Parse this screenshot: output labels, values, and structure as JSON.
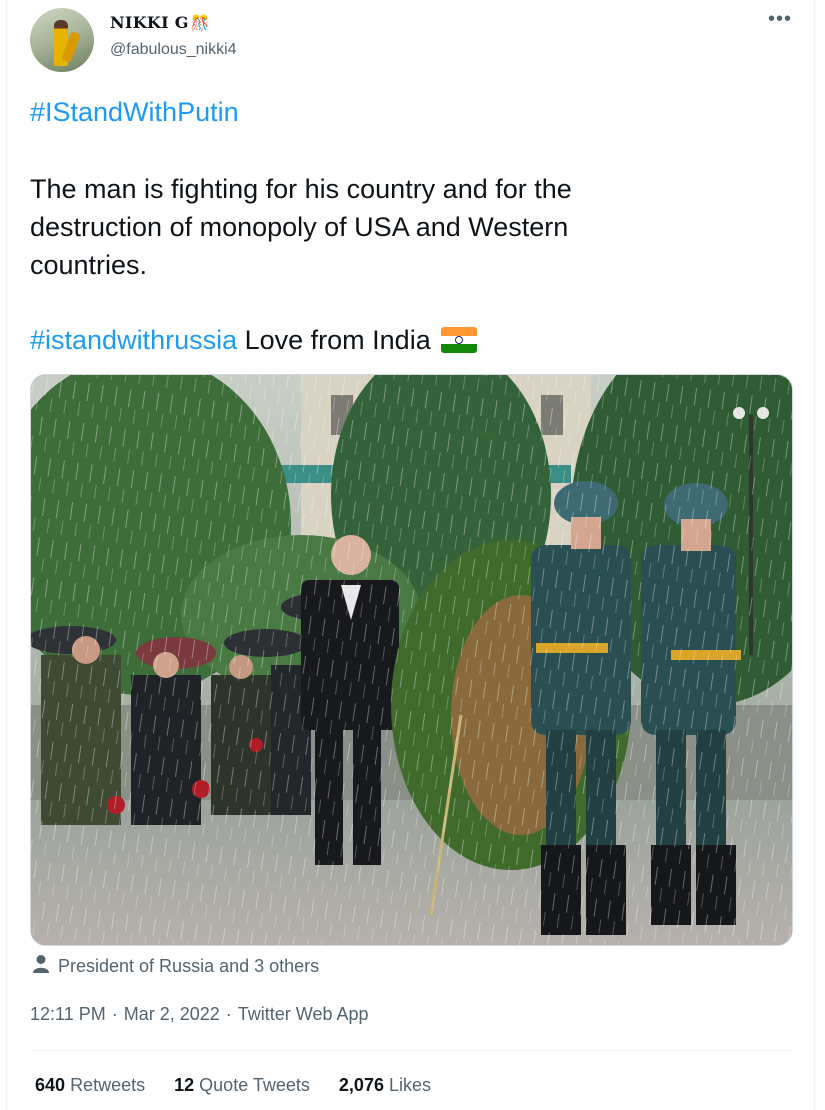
{
  "user": {
    "display_name": "NIKKI G",
    "name_emoji": "🎊",
    "handle": "@fabulous_nikki4",
    "more_icon": "more-horizontal-icon"
  },
  "tweet": {
    "hashtag_1": "#IStandWithPutin",
    "line_1": "The man is fighting for his country and for the",
    "line_2": "destruction of monopoly of USA and Western",
    "line_3": "countries.",
    "hashtag_2": "#istandwithrussia",
    "line_4_rest": " Love from India",
    "flag_icon": "india-flag-icon"
  },
  "colors": {
    "link": "#1d9bf0",
    "text": "#0f1419",
    "secondary": "#536471",
    "flag_saffron": "#ff9933",
    "flag_white": "#ffffff",
    "flag_green": "#138808"
  },
  "media": {
    "tagged_icon": "person-icon",
    "tagged_text": "President of Russia and 3 others"
  },
  "meta": {
    "time": "12:11 PM",
    "date": "Mar 2, 2022",
    "source": "Twitter Web App",
    "separator": "·"
  },
  "stats": {
    "retweets_count": "640",
    "retweets_label": "Retweets",
    "quotes_count": "12",
    "quotes_label": "Quote Tweets",
    "likes_count": "2,076",
    "likes_label": "Likes"
  }
}
